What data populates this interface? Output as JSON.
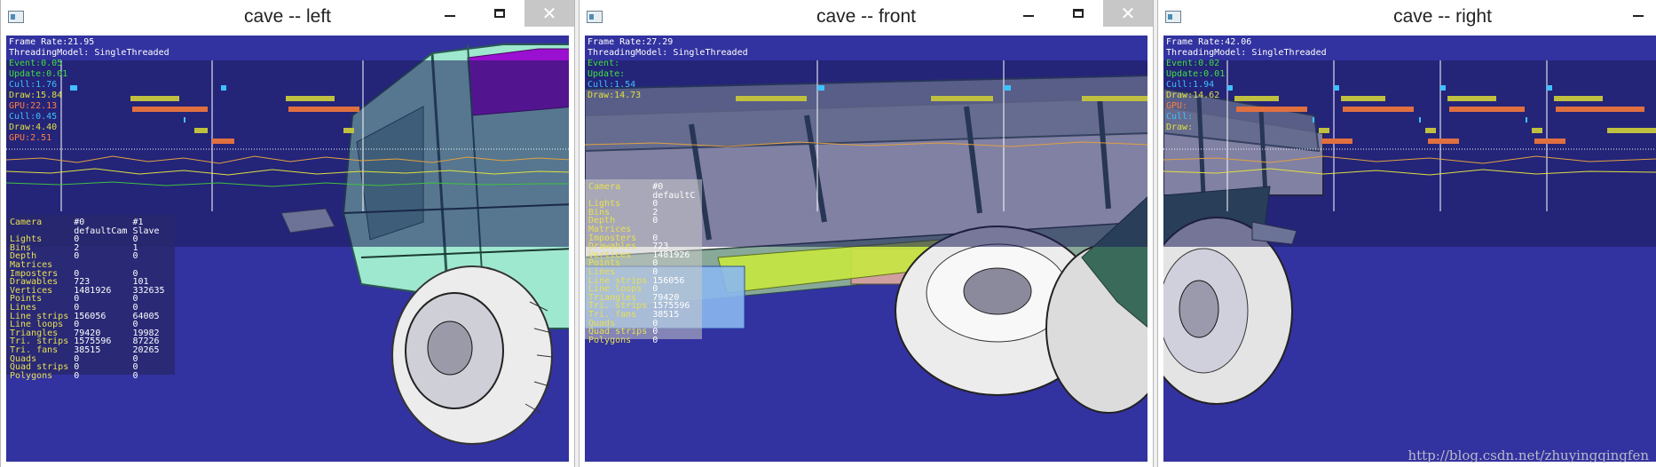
{
  "windows": [
    {
      "title": "cave -- left",
      "stats": {
        "frame_rate": "Frame Rate:21.95",
        "threading": "ThreadingModel: SingleThreaded",
        "event": "Event:0.05",
        "update": "Update:0.01",
        "cull": "Cull:1.76",
        "draw": "Draw:15.84",
        "gpu": "GPU:22.13",
        "cull2": "Cull:0.45",
        "draw2": "Draw:4.40",
        "gpu2": "GPU:2.51"
      }
    },
    {
      "title": "cave -- front",
      "stats": {
        "frame_rate": "Frame Rate:27.29",
        "threading": "ThreadingModel: SingleThreaded",
        "event": "Event:",
        "update": "Update:",
        "cull": "Cull:1.54",
        "draw": "Draw:14.73"
      }
    },
    {
      "title": "cave -- right",
      "stats": {
        "frame_rate": "Frame Rate:42.06",
        "threading": "ThreadingModel: SingleThreaded",
        "event": "Event:0.02",
        "update": "Update:0.01",
        "cull": "Cull:1.94",
        "draw": "Draw:14.62",
        "gpu": "GPU:",
        "cull2": "Cull:",
        "draw2": "Draw:"
      }
    }
  ],
  "camera_table": {
    "header": [
      "Camera",
      "#0",
      "#1"
    ],
    "header2": [
      "",
      "defaultCam",
      "Slave"
    ],
    "rows": [
      [
        "Lights",
        "0",
        "0"
      ],
      [
        "Bins",
        "2",
        "1"
      ],
      [
        "Depth",
        "0",
        "0"
      ],
      [
        "Matrices",
        "",
        ""
      ],
      [
        "Imposters",
        "0",
        "0"
      ],
      [
        "Drawables",
        "723",
        "101"
      ],
      [
        "Vertices",
        "1481926",
        "332635"
      ],
      [
        "Points",
        "0",
        "0"
      ],
      [
        "Lines",
        "0",
        "0"
      ],
      [
        "Line strips",
        "156056",
        "64005"
      ],
      [
        "Line loops",
        "0",
        "0"
      ],
      [
        "Triangles",
        "79420",
        "19982"
      ],
      [
        "Tri. strips",
        "1575596",
        "87226"
      ],
      [
        "Tri. fans",
        "38515",
        "20265"
      ],
      [
        "Quads",
        "0",
        "0"
      ],
      [
        "Quad strips",
        "0",
        "0"
      ],
      [
        "Polygons",
        "0",
        "0"
      ]
    ]
  },
  "front_table": {
    "header": [
      "Camera",
      "#0"
    ],
    "header2": [
      "",
      "defaultC"
    ],
    "rows": [
      [
        "Lights",
        "0"
      ],
      [
        "Bins",
        "2"
      ],
      [
        "Depth",
        "0"
      ],
      [
        "Matrices",
        ""
      ],
      [
        "Imposters",
        "0"
      ],
      [
        "Drawables",
        "723"
      ],
      [
        "Vertices",
        "1481926"
      ],
      [
        "Points",
        "0"
      ],
      [
        "Lines",
        "0"
      ],
      [
        "Line strips",
        "156056"
      ],
      [
        "Line loops",
        "0"
      ],
      [
        "Triangles",
        "79420"
      ],
      [
        "Tri. strips",
        "1575596"
      ],
      [
        "Tri. fans",
        "38515"
      ],
      [
        "Quads",
        "0"
      ],
      [
        "Quad strips",
        "0"
      ],
      [
        "Polygons",
        "0"
      ]
    ]
  },
  "watermark": "http://blog.csdn.net/zhuyingqingfen",
  "colors": {
    "viewport_bg": "#3232a0",
    "stat_white": "#ffffff",
    "stat_green": "#40e040",
    "stat_cyan": "#40c0ff",
    "stat_yellow": "#e0e040",
    "stat_orange": "#ff8040",
    "truck_cab": "#9fe8d0",
    "truck_bed": "#ffffff",
    "tire": "#e8e8e8"
  }
}
